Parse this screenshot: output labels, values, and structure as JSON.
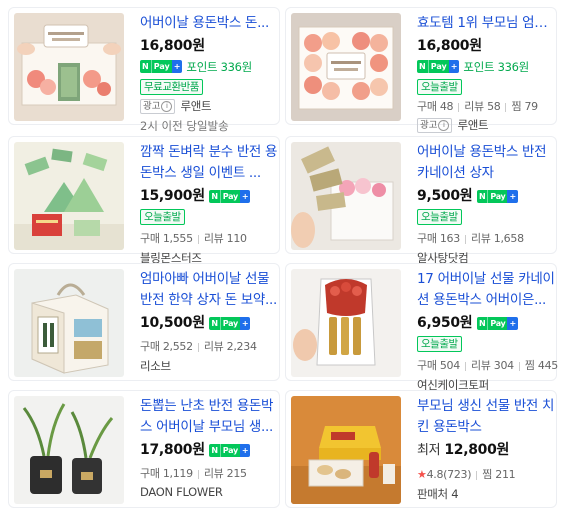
{
  "products": [
    {
      "title": "어버이날 용돈박스 돈...",
      "price": "16,800원",
      "npay": {
        "n": "N",
        "pay": "Pay",
        "plus": "+"
      },
      "point": "포인트 336원",
      "badge": "무료교환반품",
      "ad": "광고",
      "ad_info": "i",
      "seller": "루앤트",
      "shipping": "2시 이전 당일발송"
    },
    {
      "title": "효도템 1위 부모님 엄마...",
      "price": "16,800원",
      "npay": {
        "n": "N",
        "pay": "Pay",
        "plus": "+"
      },
      "point": "포인트 336원",
      "badge": "오늘출발",
      "stats": {
        "purchase": "구매 48",
        "review": "리뷰 58",
        "wish": "찜 79"
      },
      "ad": "광고",
      "ad_info": "i",
      "seller": "루앤트"
    },
    {
      "title": "깜짝 돈벼락 분수 반전 용돈박스 생일 이벤트 ...",
      "price": "15,900원",
      "npay": {
        "n": "N",
        "pay": "Pay",
        "plus": "+"
      },
      "badge": "오늘출발",
      "stats": {
        "purchase": "구매 1,555",
        "review": "리뷰 110"
      },
      "seller": "블링몬스터즈"
    },
    {
      "title": "어버이날 용돈박스 반전 카네이션 상자",
      "price": "9,500원",
      "npay": {
        "n": "N",
        "pay": "Pay",
        "plus": "+"
      },
      "badge": "오늘출발",
      "stats": {
        "purchase": "구매 163",
        "review": "리뷰 1,658"
      },
      "seller": "알사탕닷컴"
    },
    {
      "title": "엄마아빠 어버이날 선물 반전 한약 상자 돈 보약...",
      "price": "10,500원",
      "npay": {
        "n": "N",
        "pay": "Pay",
        "plus": "+"
      },
      "stats": {
        "purchase": "구매 2,552",
        "review": "리뷰 2,234"
      },
      "seller": "리소브"
    },
    {
      "title": "17 어버이날 선물 카네이션 용돈박스 어버이은...",
      "price": "6,950원",
      "npay": {
        "n": "N",
        "pay": "Pay",
        "plus": "+"
      },
      "badge": "오늘출발",
      "stats": {
        "purchase": "구매 504",
        "review": "리뷰 304",
        "wish": "찜 445"
      },
      "seller": "여신케이크토퍼"
    },
    {
      "title": "돈뽑는 난초 반전 용돈박스 어버이날 부모님 생...",
      "price": "17,800원",
      "npay": {
        "n": "N",
        "pay": "Pay",
        "plus": "+"
      },
      "stats": {
        "purchase": "구매 1,119",
        "review": "리뷰 215"
      },
      "seller": "DAON FLOWER"
    },
    {
      "title": "부모님 생신 선물 반전 치킨 용돈박스",
      "price_prefix": "최저",
      "price": "12,800원",
      "rating": {
        "star": "★",
        "score": "4.8(723)",
        "wish": "찜 211"
      },
      "sellers": "판매처 4"
    }
  ]
}
